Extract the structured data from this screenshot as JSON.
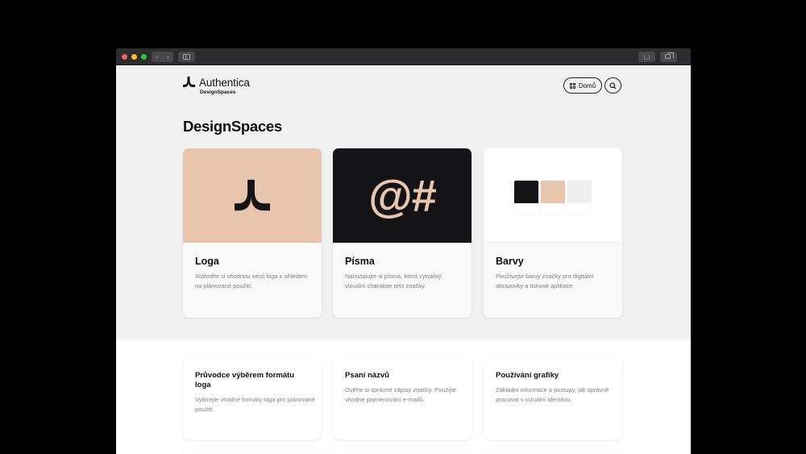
{
  "browser": {
    "nav_back": "‹",
    "nav_forward": "›"
  },
  "header": {
    "brand_name": "Authentica",
    "brand_sub": "DesignSpaces",
    "home_label": "Domů"
  },
  "page_title": "DesignSpaces",
  "cards": [
    {
      "title": "Loga",
      "description": "Stáhněte si vhodnou verzi loga s ohledem na plánované použití.",
      "icon": "brand-logo-mark"
    },
    {
      "title": "Písma",
      "description": "Nainstalujte si písma, která vytvářejí vizuální charakter této značky.",
      "glyphs": "@#"
    },
    {
      "title": "Barvy",
      "description": "Používejte barvy značky pro digitální obrazovky a tiskové aplikace.",
      "swatches": [
        "#141417",
        "#e8c6ad",
        "#efefef"
      ]
    }
  ],
  "guides": [
    {
      "title": "Průvodce výběrem formátu loga",
      "description": "Vybírejte vhodné formáty loga pro plánované použití."
    },
    {
      "title": "Psaní názvů",
      "description": "Ověřte si správné zápisy značky. Použijte vhodné pojmenování e-mailů."
    },
    {
      "title": "Používání grafiky",
      "description": "Základní informace a postupy, jak správně pracovat s vizuální identitou."
    }
  ],
  "colors": {
    "accent_peach": "#e8c6ad",
    "dark": "#141417",
    "page_bg": "#f0f0f0"
  }
}
